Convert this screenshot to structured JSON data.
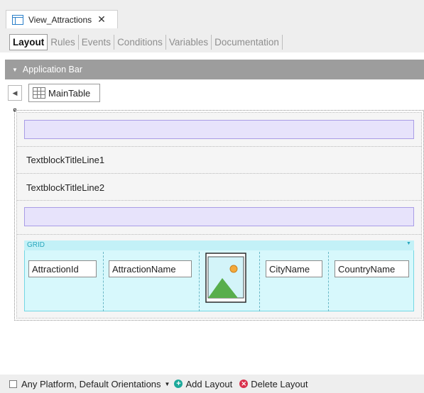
{
  "document_tab": {
    "title": "View_Attractions",
    "close": "✕"
  },
  "editor_tabs": [
    {
      "label": "Layout",
      "active": true
    },
    {
      "label": "Rules",
      "active": false
    },
    {
      "label": "Events",
      "active": false
    },
    {
      "label": "Conditions",
      "active": false
    },
    {
      "label": "Variables",
      "active": false
    },
    {
      "label": "Documentation",
      "active": false
    }
  ],
  "application_bar": {
    "label": "Application Bar"
  },
  "toolbar": {
    "main_table_label": "MainTable"
  },
  "layout": {
    "textblock1": "TextblockTitleLine1",
    "textblock2": "TextblockTitleLine2"
  },
  "grid": {
    "label": "GRID",
    "columns": [
      "AttractionId",
      "AttractionName",
      "CityName",
      "CountryName"
    ]
  },
  "footer": {
    "platform": "Any Platform, Default Orientations",
    "add_layout": "Add Layout",
    "delete_layout": "Delete Layout"
  },
  "colors": {
    "accent": "#2a7fc9",
    "grid_bg": "#d7f8fc",
    "placeholder_purple": "#e7e3fb",
    "add_green": "#1aa89a",
    "delete_red": "#d9314c"
  }
}
